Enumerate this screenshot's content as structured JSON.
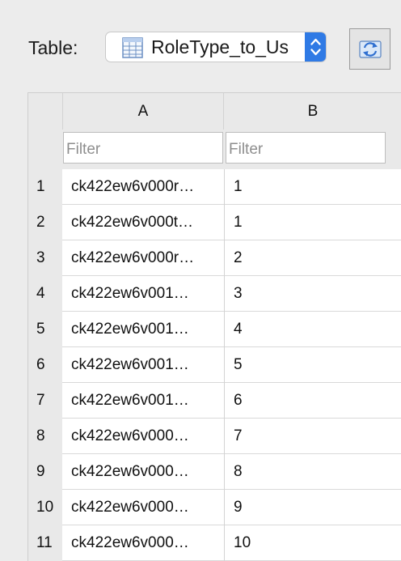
{
  "toolbar": {
    "table_label": "Table:",
    "selected_table": "RoleType_to_Us",
    "icons": {
      "table": "table-icon",
      "stepper": "chevron-up-down-icon",
      "refresh": "refresh-icon"
    },
    "accent_color": "#2f7ae5"
  },
  "grid": {
    "columns": [
      "A",
      "B"
    ],
    "filter_placeholder": "Filter",
    "rows": [
      {
        "num": "1",
        "a": "ck422ew6v000r…",
        "b": "1"
      },
      {
        "num": "2",
        "a": "ck422ew6v000t…",
        "b": "1"
      },
      {
        "num": "3",
        "a": "ck422ew6v000r…",
        "b": "2"
      },
      {
        "num": "4",
        "a": "ck422ew6v001…",
        "b": "3"
      },
      {
        "num": "5",
        "a": "ck422ew6v001…",
        "b": "4"
      },
      {
        "num": "6",
        "a": "ck422ew6v001…",
        "b": "5"
      },
      {
        "num": "7",
        "a": "ck422ew6v001…",
        "b": "6"
      },
      {
        "num": "8",
        "a": "ck422ew6v000…",
        "b": "7"
      },
      {
        "num": "9",
        "a": "ck422ew6v000…",
        "b": "8"
      },
      {
        "num": "10",
        "a": "ck422ew6v000…",
        "b": "9"
      },
      {
        "num": "11",
        "a": "ck422ew6v000…",
        "b": "10"
      }
    ]
  }
}
